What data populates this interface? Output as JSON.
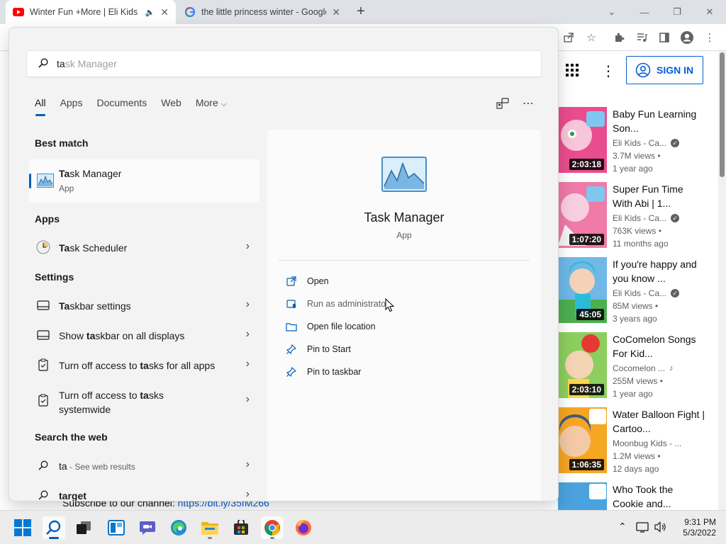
{
  "browser": {
    "tabs": [
      {
        "title": "Winter Fun +More | Eli Kids",
        "favicon": "youtube-icon",
        "audio": true,
        "active": true
      },
      {
        "title": "the little princess winter - Google",
        "favicon": "google-icon",
        "active": false
      }
    ],
    "new_tab": "+",
    "controls": {
      "minimize": "—",
      "restore": "❐",
      "close": "✕",
      "tab_search": "⌄"
    }
  },
  "youtube": {
    "sign_in": "SIGN IN",
    "videos": [
      {
        "title": "Baby Fun Learning Son...",
        "channel": "Eli Kids - Ca...",
        "verified": true,
        "views": "3.7M views •",
        "age": "1 year ago",
        "duration": "2:03:18",
        "thumb_color": "#e94d8d"
      },
      {
        "title": "Super Fun Time With Abi | 1...",
        "channel": "Eli Kids - Ca...",
        "verified": true,
        "views": "763K views •",
        "age": "11 months ago",
        "duration": "1:07:20",
        "thumb_color": "#f07aa8"
      },
      {
        "title": "If you're happy and you know ...",
        "channel": "Eli Kids - Ca...",
        "verified": true,
        "views": "85M views •",
        "age": "3 years ago",
        "duration": "45:05",
        "thumb_color": "#6fb8e8"
      },
      {
        "title": "CoComelon Songs For Kid...",
        "channel": "Cocomelon ...",
        "verified": false,
        "music": true,
        "views": "255M views •",
        "age": "1 year ago",
        "duration": "2:03:10",
        "thumb_color": "#8ccf5e"
      },
      {
        "title": "Water Balloon Fight | Cartoo...",
        "channel": "Moonbug Kids - ...",
        "verified": false,
        "views": "1.2M views •",
        "age": "12 days ago",
        "duration": "1:06:35",
        "thumb_color": "#f5a623"
      },
      {
        "title": "Who Took the Cookie and...",
        "channel": "",
        "verified": false,
        "views": "",
        "age": "",
        "duration": "",
        "thumb_color": "#4aa3df"
      }
    ],
    "subscribe_text": "Subscribe to our channel: ",
    "subscribe_link": "https://bit.ly/35fM266"
  },
  "search": {
    "typed": "ta",
    "hint": "sk Manager",
    "filters": [
      "All",
      "Apps",
      "Documents",
      "Web",
      "More"
    ],
    "more_chevron": "⌵",
    "best_match_title": "Best match",
    "best_match": {
      "name_bold": "Ta",
      "name_rest": "sk Manager",
      "type": "App"
    },
    "apps_title": "Apps",
    "apps": [
      {
        "bold": "Ta",
        "rest": "sk Scheduler"
      }
    ],
    "settings_title": "Settings",
    "settings": [
      {
        "pre": "",
        "bold": "Ta",
        "post": "skbar settings"
      },
      {
        "pre": "Show ",
        "bold": "ta",
        "post": "skbar on all displays"
      },
      {
        "pre": "Turn off access to ",
        "bold": "ta",
        "post": "sks for all apps"
      },
      {
        "pre": "Turn off access to ",
        "bold": "ta",
        "post": "sks systemwide"
      }
    ],
    "web_title": "Search the web",
    "web": [
      {
        "bold": "ta",
        "suffix": " - See web results"
      },
      {
        "bold": "target",
        "suffix": ""
      }
    ],
    "detail": {
      "name": "Task Manager",
      "type": "App",
      "actions": [
        "Open",
        "Run as administrator",
        "Open file location",
        "Pin to Start",
        "Pin to taskbar"
      ]
    }
  },
  "taskbar": {
    "time": "9:31 PM",
    "date": "5/3/2022"
  }
}
